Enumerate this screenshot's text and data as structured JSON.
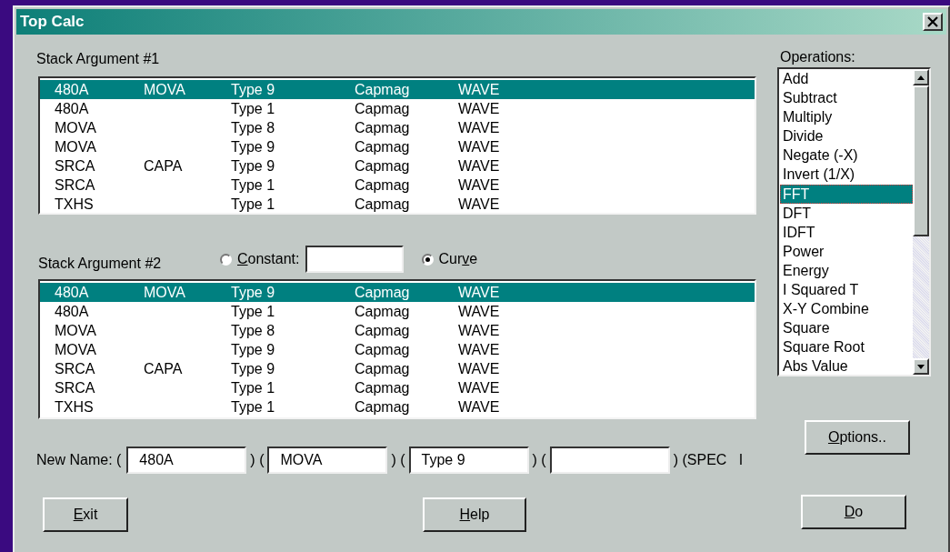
{
  "window": {
    "title": "Top Calc"
  },
  "stack_1": {
    "label": "Stack Argument #1",
    "rows": [
      {
        "cells": [
          "480A",
          "MOVA",
          "Type 9",
          "Capmag",
          "WAVE"
        ],
        "selected": true
      },
      {
        "cells": [
          "480A",
          null,
          "Type 1",
          "Capmag",
          "WAVE"
        ],
        "selected": false
      },
      {
        "cells": [
          "MOVA",
          null,
          "Type 8",
          "Capmag",
          "WAVE"
        ],
        "selected": false
      },
      {
        "cells": [
          "MOVA",
          null,
          "Type 9",
          "Capmag",
          "WAVE"
        ],
        "selected": false
      },
      {
        "cells": [
          "SRCA",
          "CAPA",
          "Type 9",
          "Capmag",
          "WAVE"
        ],
        "selected": false
      },
      {
        "cells": [
          "SRCA",
          null,
          "Type 1",
          "Capmag",
          "WAVE"
        ],
        "selected": false
      },
      {
        "cells": [
          "TXHS",
          null,
          "Type 1",
          "Capmag",
          "WAVE"
        ],
        "selected": false
      }
    ]
  },
  "stack_2": {
    "label": "Stack Argument #2",
    "radios": [
      {
        "kind": "with-field",
        "key": "C",
        "post": "onstant:",
        "selected": false
      },
      {
        "kind": "plain",
        "pre": "Cur",
        "key": "v",
        "post": "e",
        "selected": true
      }
    ],
    "rows": [
      {
        "cells": [
          "480A",
          "MOVA",
          "Type 9",
          "Capmag",
          "WAVE"
        ],
        "selected": true
      },
      {
        "cells": [
          "480A",
          null,
          "Type 1",
          "Capmag",
          "WAVE"
        ],
        "selected": false
      },
      {
        "cells": [
          "MOVA",
          null,
          "Type 8",
          "Capmag",
          "WAVE"
        ],
        "selected": false
      },
      {
        "cells": [
          "MOVA",
          null,
          "Type 9",
          "Capmag",
          "WAVE"
        ],
        "selected": false
      },
      {
        "cells": [
          "SRCA",
          "CAPA",
          "Type 9",
          "Capmag",
          "WAVE"
        ],
        "selected": false
      },
      {
        "cells": [
          "SRCA",
          null,
          "Type 1",
          "Capmag",
          "WAVE"
        ],
        "selected": false
      },
      {
        "cells": [
          "TXHS",
          null,
          "Type 1",
          "Capmag",
          "WAVE"
        ],
        "selected": false
      }
    ]
  },
  "new_name": {
    "label": "New Name: (",
    "fields": [
      {
        "value": "480A",
        "after": ") ("
      },
      {
        "value": "MOVA",
        "after": ") ("
      },
      {
        "value": "Type 9",
        "after": ") ("
      },
      {
        "after": ") (SPEC   I"
      }
    ]
  },
  "operations": {
    "label": "Operations:",
    "items": [
      {
        "label": "Add",
        "selected": false
      },
      {
        "label": "Subtract",
        "selected": false
      },
      {
        "label": "Multiply",
        "selected": false
      },
      {
        "label": "Divide",
        "selected": false
      },
      {
        "label": "Negate (-X)",
        "selected": false
      },
      {
        "label": "Invert (1/X)",
        "selected": false
      },
      {
        "label": "FFT",
        "selected": true
      },
      {
        "label": "DFT",
        "selected": false
      },
      {
        "label": "IDFT",
        "selected": false
      },
      {
        "label": "Power",
        "selected": false
      },
      {
        "label": "Energy",
        "selected": false
      },
      {
        "label": "I Squared T",
        "selected": false
      },
      {
        "label": "X-Y Combine",
        "selected": false
      },
      {
        "label": "Square",
        "selected": false
      },
      {
        "label": "Square Root",
        "selected": false
      },
      {
        "label": "Abs Value",
        "selected": false
      }
    ]
  },
  "buttons": [
    {
      "kind": "exit",
      "key": "E",
      "post": "xit"
    },
    {
      "kind": "help",
      "key": "H",
      "post": "elp"
    },
    {
      "kind": "options",
      "key": "O",
      "post": "ptions.."
    },
    {
      "kind": "do",
      "key": "D",
      "post": "o"
    }
  ]
}
